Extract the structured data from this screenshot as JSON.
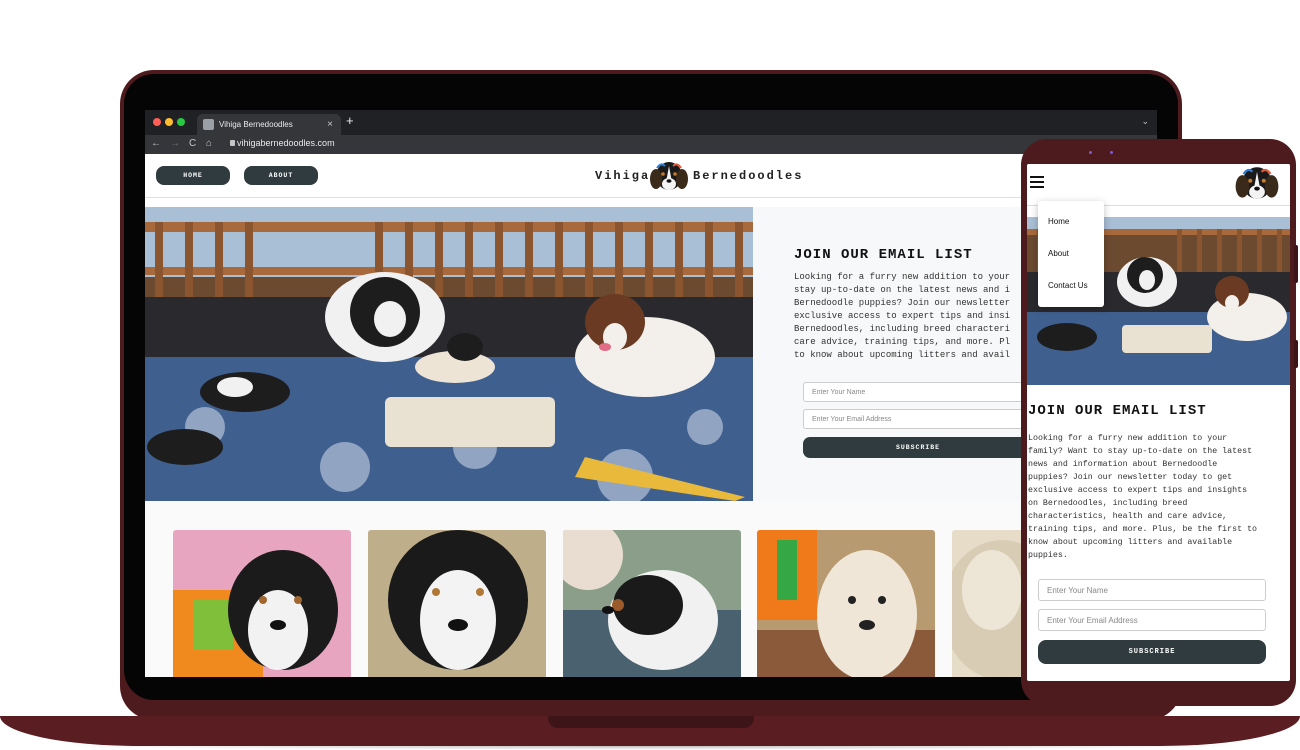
{
  "browser": {
    "tab_title": "Vihiga Bernedoodles",
    "tab_close": "×",
    "new_tab": "+",
    "tab_menu": "⌄",
    "url": "vihigabernedoodles.com",
    "nav": {
      "back": "←",
      "forward": "→",
      "reload": "C",
      "home": "⌂"
    }
  },
  "site": {
    "nav": {
      "home": "HOME",
      "about": "ABOUT"
    },
    "brand_left": "Vihiga",
    "brand_right": "Bernedoodles",
    "join_title": "JOIN OUR EMAIL LIST",
    "join_lines": [
      "Looking for a furry new addition to your",
      "stay up-to-date on the latest news and i",
      "Bernedoodle puppies? Join our newsletter",
      "exclusive access to expert tips and insi",
      "Bernedoodles, including breed characteri",
      "care advice, training tips, and more. Pl",
      "to know about upcoming litters and avail"
    ],
    "name_placeholder": "Enter Your Name",
    "email_placeholder": "Enter Your Email Address",
    "subscribe": "SUBSCRIBE"
  },
  "mobile": {
    "menu": {
      "home": "Home",
      "about": "About",
      "contact": "Contact Us"
    },
    "join_title": "JOIN OUR EMAIL LIST",
    "join_body": "Looking for a furry new addition to your\nfamily? Want to stay up-to-date on the latest\nnews and information about Bernedoodle\npuppies? Join our newsletter today to get\nexclusive access to expert tips and insights\non Bernedoodles, including breed\ncharacteristics, health and care advice,\ntraining tips, and more. Plus, be the first to\nknow about upcoming litters and available\npuppies.",
    "name_placeholder": "Enter Your Name",
    "email_placeholder": "Enter Your Email Address",
    "subscribe": "SUBSCRIBE"
  },
  "colors": {
    "device_frame": "#4d1a1d",
    "button_dark": "#2f3b3e",
    "browser_dark": "#202124"
  }
}
